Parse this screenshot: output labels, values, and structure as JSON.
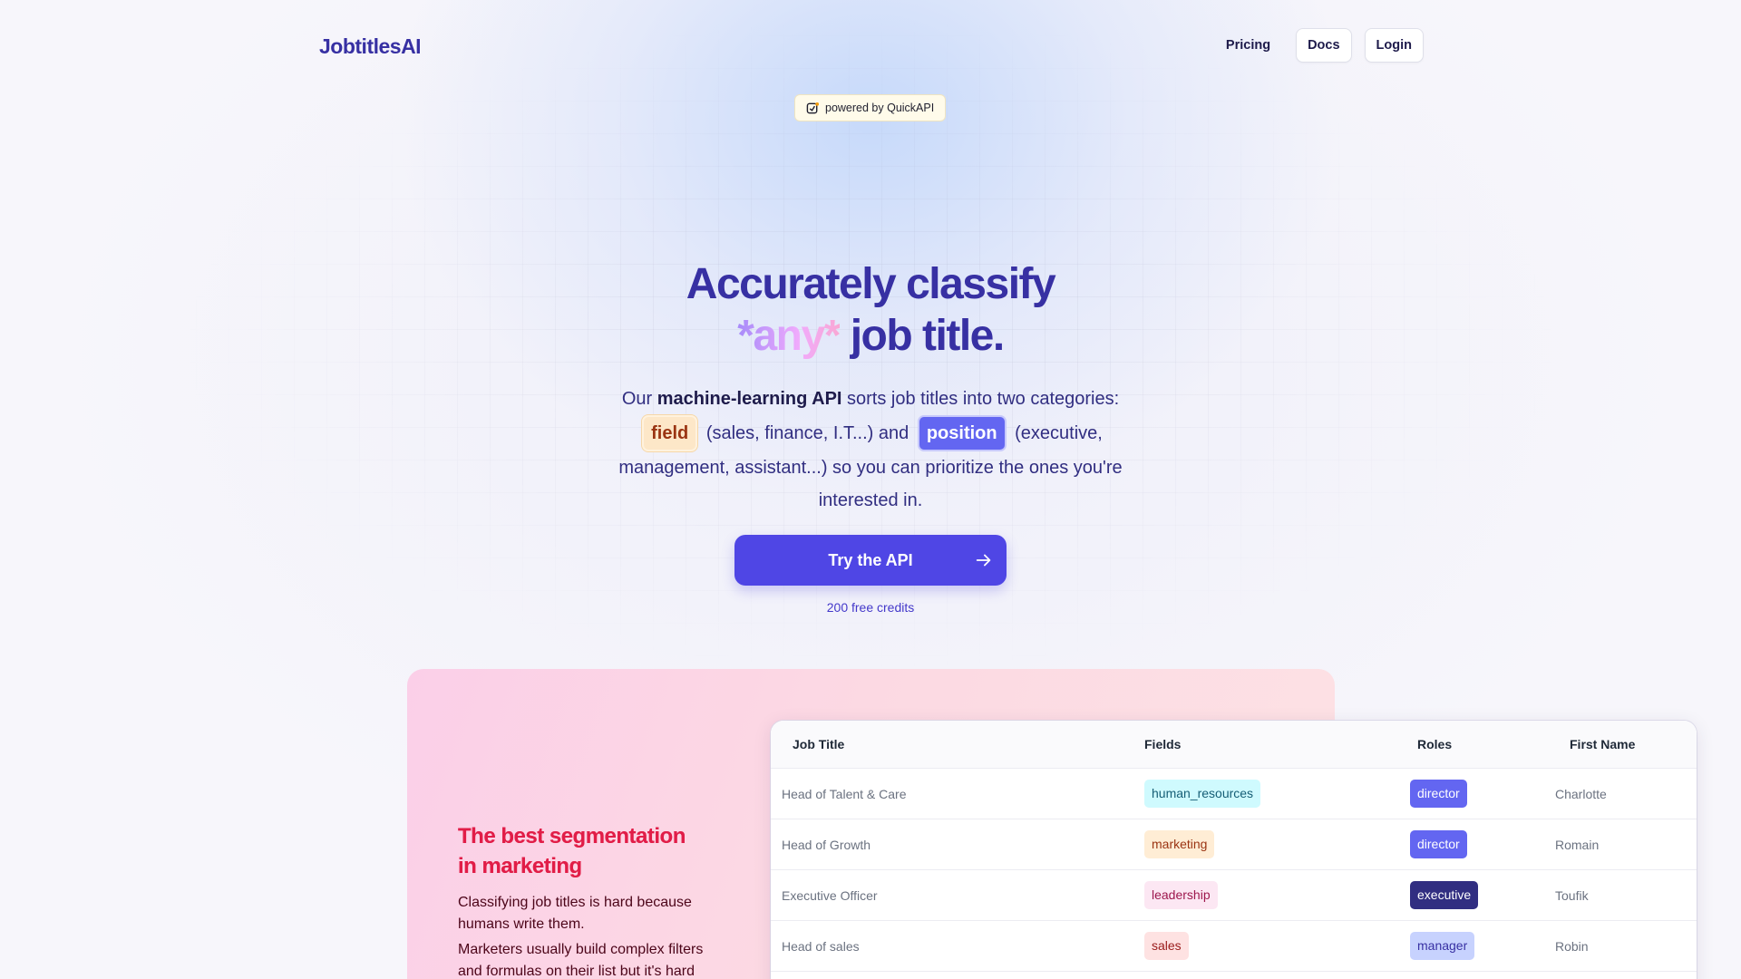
{
  "header": {
    "logo": "JobtitlesAI",
    "nav": {
      "pricing": "Pricing",
      "docs": "Docs",
      "login": "Login"
    }
  },
  "powered_by": "powered by QuickAPI",
  "hero": {
    "title_line1": "Accurately classify",
    "title_any": "*any*",
    "title_rest": " job title.",
    "desc_pre": "Our ",
    "desc_bold": "machine-learning API",
    "desc_mid": " sorts job titles into two categories: ",
    "tag_field": "field",
    "desc_field_examples": " (sales, finance, I.T...) and ",
    "tag_position": "position",
    "desc_post": " (executive, management, assistant...) so you can prioritize the ones you're interested in.",
    "cta_label": "Try the API",
    "credits": "200 free credits"
  },
  "marketing": {
    "title_line1": "The best segmentation",
    "title_line2": "in marketing",
    "p1": "Classifying job titles is hard because humans write them.",
    "p2": "Marketers usually build complex filters and formulas on their list but it's hard"
  },
  "table": {
    "headers": {
      "job_title": "Job Title",
      "fields": "Fields",
      "roles": "Roles",
      "first_name": "First Name"
    },
    "rows": [
      {
        "title": "Head of Talent & Care",
        "field": "human_resources",
        "role": "director",
        "name": "Charlotte"
      },
      {
        "title": "Head of Growth",
        "field": "marketing",
        "role": "director",
        "name": "Romain"
      },
      {
        "title": "Executive Officer",
        "field": "leadership",
        "role": "executive",
        "name": "Toufik"
      },
      {
        "title": "Head of sales",
        "field": "sales",
        "role": "manager",
        "name": "Robin"
      }
    ]
  },
  "colors": {
    "brand": "#3730a3",
    "primary": "#4f46e5",
    "accent_pink": "#e11d48"
  }
}
